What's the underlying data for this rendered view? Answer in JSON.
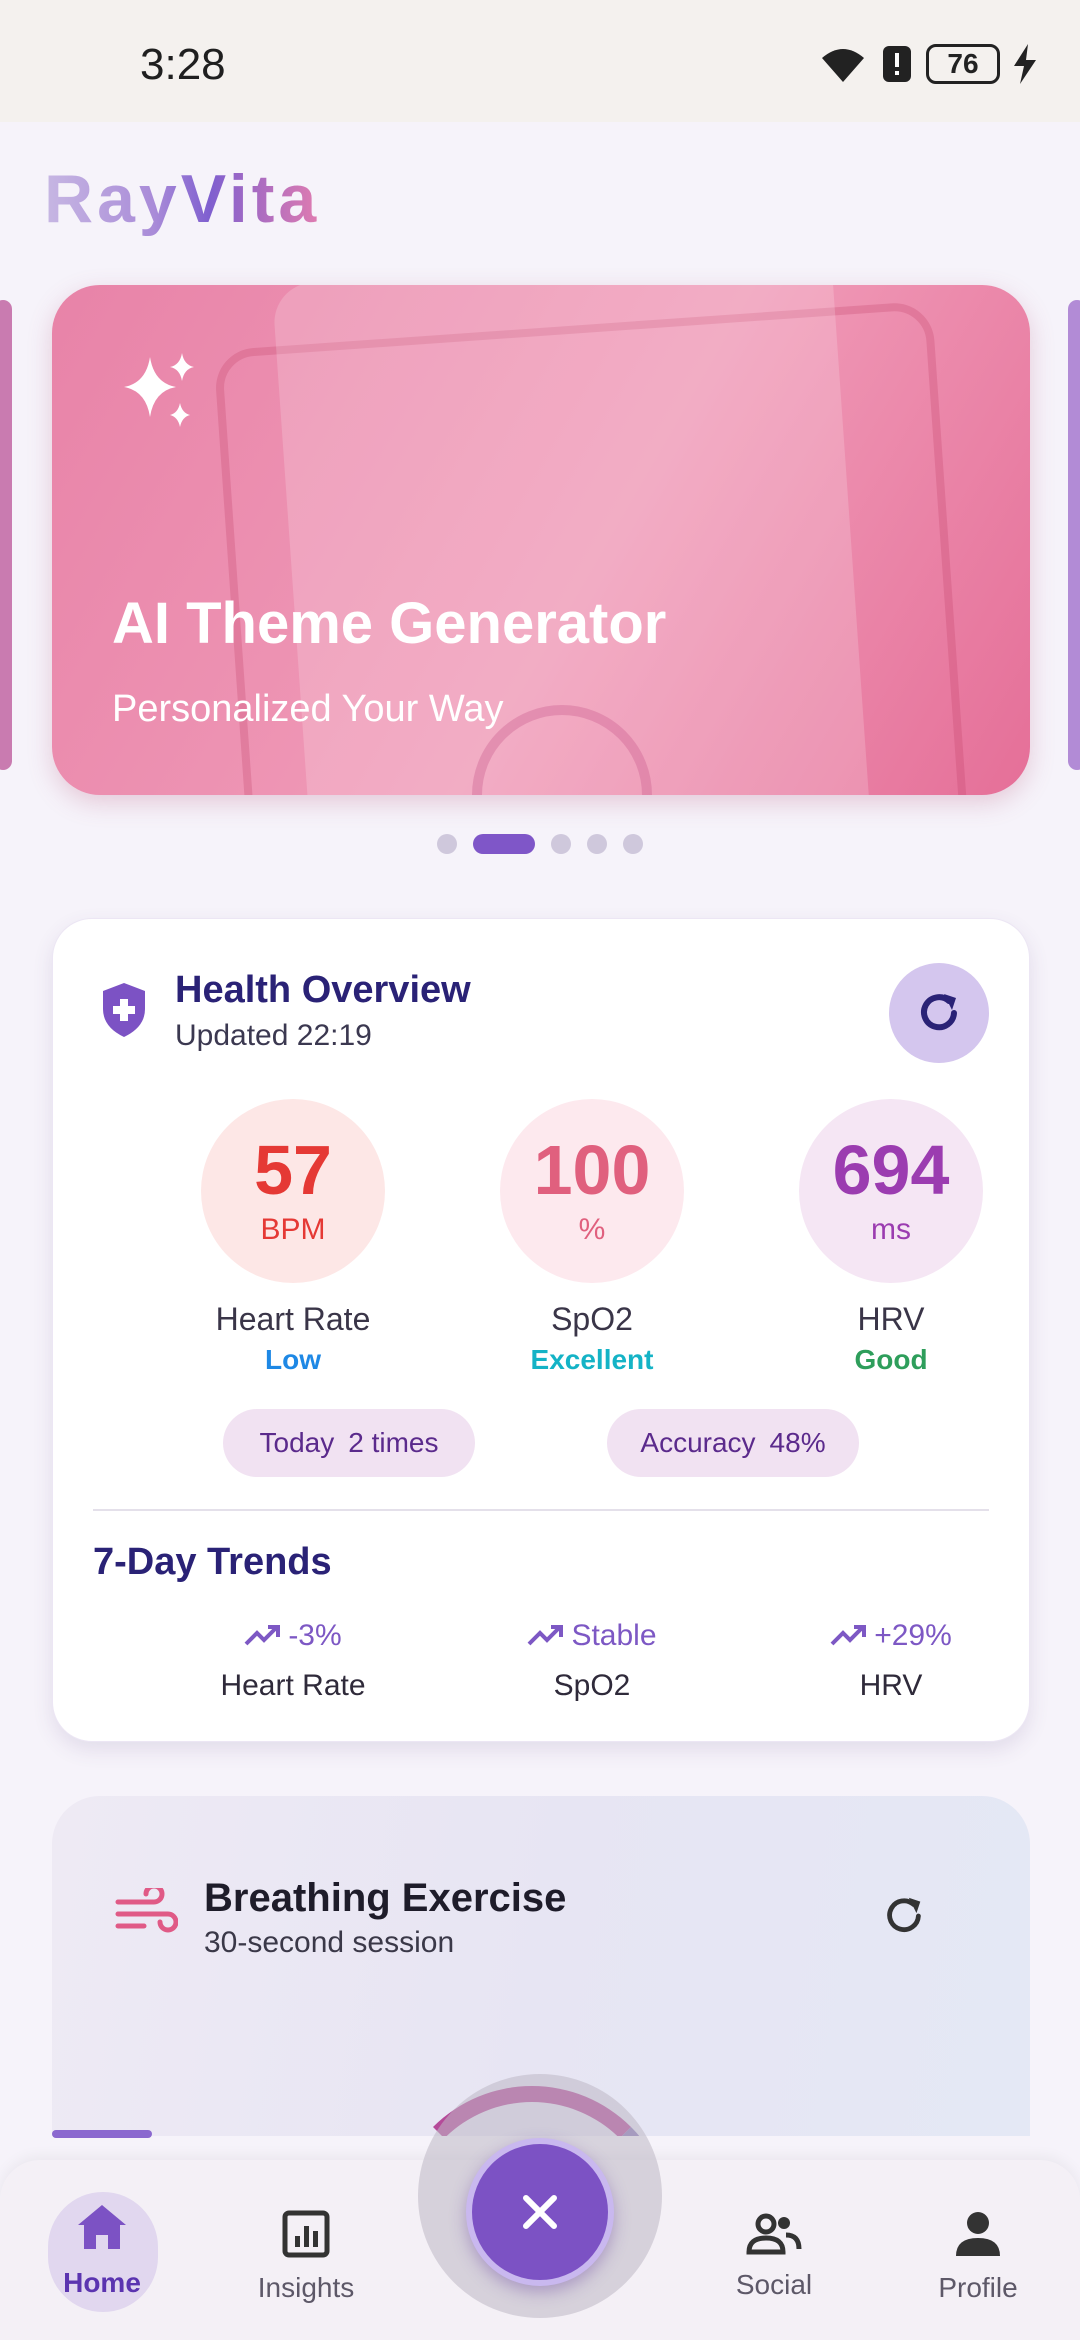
{
  "status_bar": {
    "time": "3:28",
    "battery": "76"
  },
  "app": {
    "logo": "RayVita"
  },
  "banner": {
    "title": "AI Theme Generator",
    "subtitle": "Personalized Your Way",
    "page_count": 5,
    "active_page": 2
  },
  "health": {
    "title": "Health Overview",
    "updated": "Updated 22:19",
    "metrics": [
      {
        "value": "57",
        "unit": "BPM",
        "name": "Heart Rate",
        "status": "Low",
        "color": "#e53935",
        "bg": "#fde7e6",
        "status_color": "#1e88e5"
      },
      {
        "value": "100",
        "unit": "%",
        "name": "SpO2",
        "status": "Excellent",
        "color": "#e0607e",
        "bg": "#fde9ee",
        "status_color": "#14b3c6"
      },
      {
        "value": "694",
        "unit": "ms",
        "name": "HRV",
        "status": "Good",
        "color": "#9b3cb0",
        "bg": "#f5e6f4",
        "status_color": "#2e9e5b"
      }
    ],
    "today_label": "Today",
    "today_value": "2 times",
    "accuracy_label": "Accuracy",
    "accuracy_value": "48%",
    "trends_title": "7-Day Trends",
    "trends": [
      {
        "value": "-3%",
        "name": "Heart Rate"
      },
      {
        "value": "Stable",
        "name": "SpO2"
      },
      {
        "value": "+29%",
        "name": "HRV"
      }
    ]
  },
  "breathing": {
    "title": "Breathing Exercise",
    "subtitle": "30-second session"
  },
  "nav": {
    "home": "Home",
    "insights": "Insights",
    "social": "Social",
    "profile": "Profile"
  },
  "icons": {
    "wifi": "wifi-icon",
    "alert": "alert-icon",
    "charging": "charging-icon",
    "sparkle": "sparkle-icon",
    "shield": "shield-icon",
    "refresh": "refresh-icon",
    "wind": "wind-icon",
    "close": "close-icon",
    "trend": "trending-up-icon"
  },
  "colors": {
    "accent": "#7c52c4",
    "title": "#2a2276",
    "banner": "#ec8cae"
  }
}
